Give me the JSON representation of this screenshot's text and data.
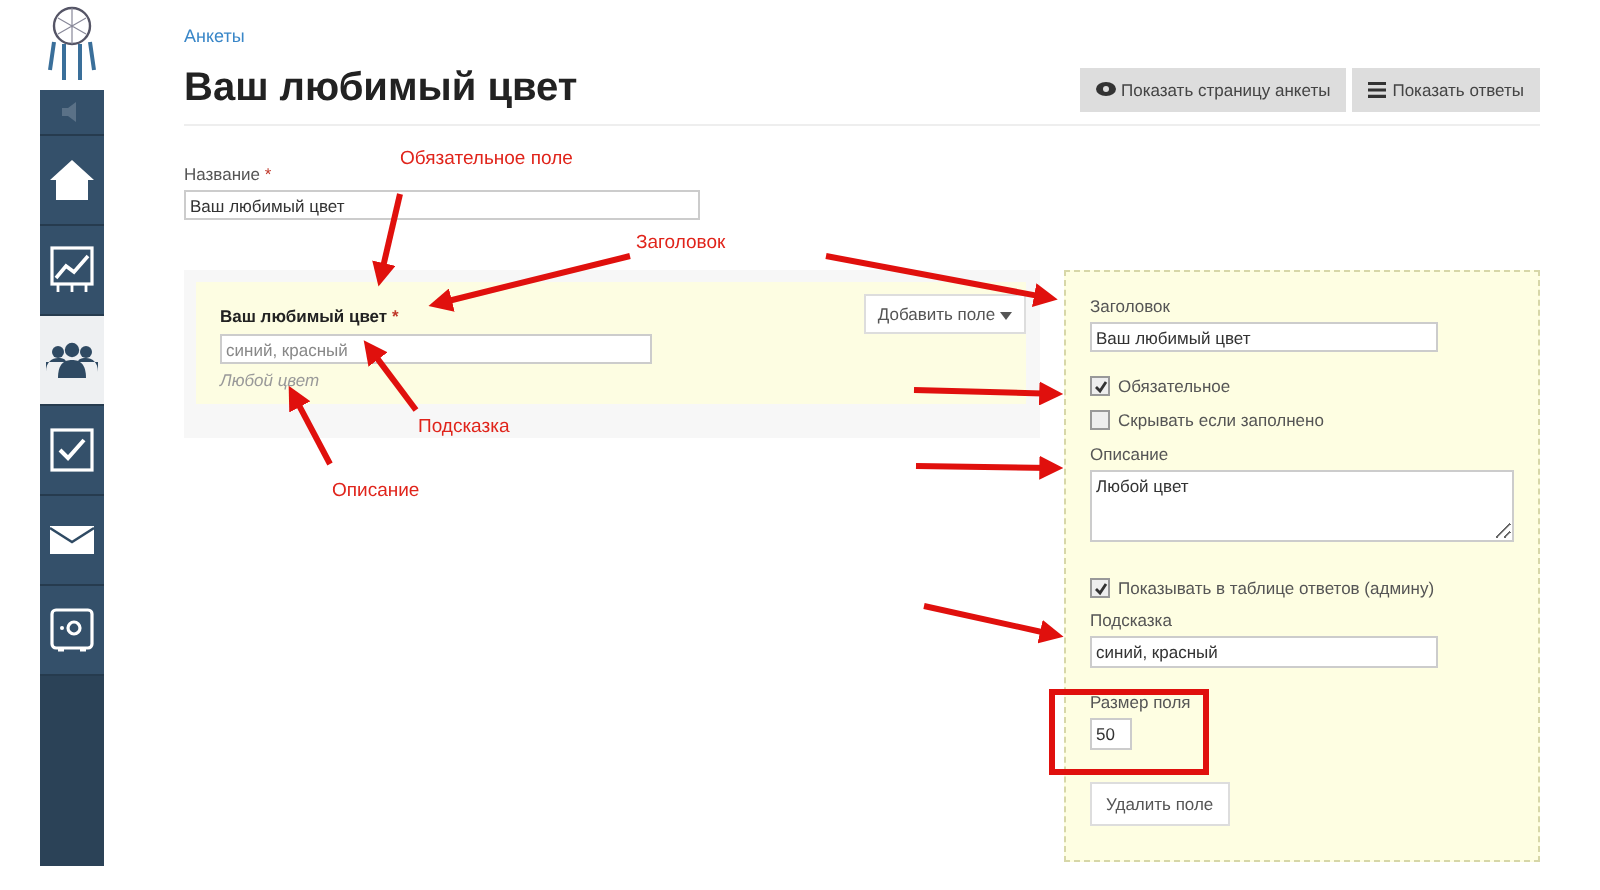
{
  "sidebar": {
    "items": [
      {
        "kind": "speaker",
        "selected": false
      },
      {
        "kind": "home",
        "selected": false
      },
      {
        "kind": "chart",
        "selected": false
      },
      {
        "kind": "people",
        "selected": true
      },
      {
        "kind": "check",
        "selected": false
      },
      {
        "kind": "mail",
        "selected": false
      },
      {
        "kind": "safe",
        "selected": false
      }
    ]
  },
  "breadcrumb": "Анкеты",
  "title": "Ваш любимый цвет",
  "header_buttons": [
    {
      "kind": "eye",
      "label": "Показать страницу анкеты"
    },
    {
      "kind": "list",
      "label": "Показать ответы"
    }
  ],
  "name_field": {
    "label": "Название",
    "required_mark": "*",
    "value": "Ваш любимый цвет"
  },
  "preview": {
    "label": "Ваш любимый цвет",
    "required_mark": "*",
    "placeholder": "синий, красный",
    "description": "Любой цвет",
    "add_button": "Добавить поле"
  },
  "editor": {
    "title_label": "Заголовок",
    "title_value": "Ваш любимый цвет",
    "checks": [
      {
        "label": "Обязательное",
        "checked": true
      },
      {
        "label": "Скрывать если заполнено",
        "checked": false
      }
    ],
    "description_label": "Описание",
    "description_value": "Любой цвет",
    "show_check": {
      "label": "Показывать в таблице ответов (админу)",
      "checked": true
    },
    "hint_label": "Подсказка",
    "hint_input": {
      "value": "синий, красный"
    },
    "size_label": "Размер поля",
    "size_value": "50",
    "delete_button": "Удалить поле"
  },
  "annotations": [
    "Обязательное поле",
    "Заголовок",
    "Подсказка",
    "Описание"
  ]
}
